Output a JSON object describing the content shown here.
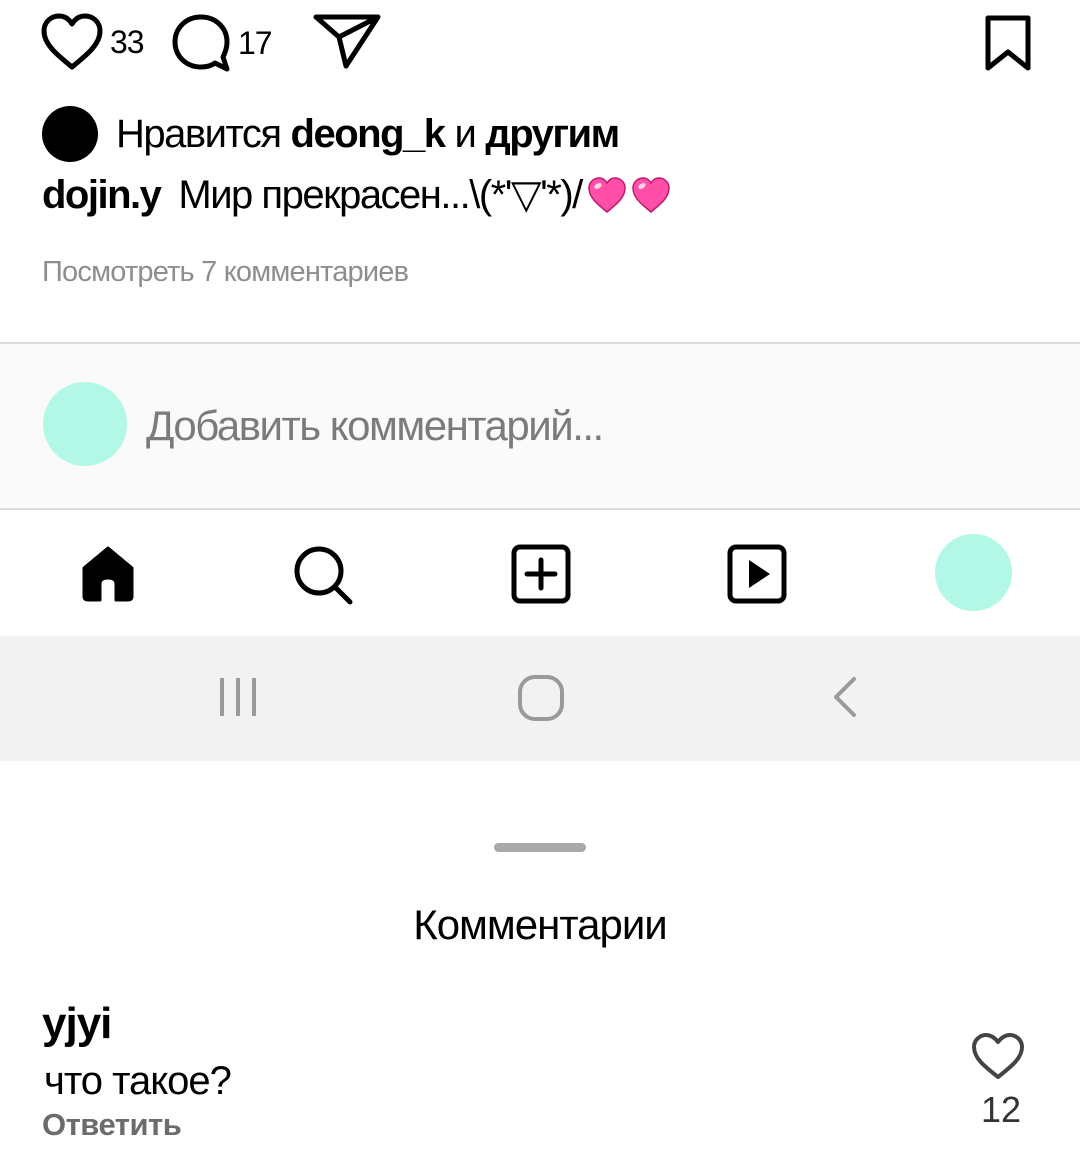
{
  "post": {
    "likes_count": "33",
    "comments_count": "17",
    "likes_prefix": "Нравится",
    "likes_user": "deong_k",
    "likes_and": "и",
    "likes_others": "другим",
    "caption_user": "dojin.y",
    "caption_text": "Мир прекрасен...\\(*'▽'*)/",
    "caption_emoji": [
      "pink-heart-icon",
      "pink-heart-icon"
    ],
    "view_comments": "Посмотреть 7 комментариев"
  },
  "add_comment": {
    "placeholder": "Добавить комментарий..."
  },
  "bottom_nav": [
    "home-icon",
    "search-icon",
    "add-post-icon",
    "reels-icon",
    "profile-avatar"
  ],
  "system_nav": [
    "recents-icon",
    "home-circle-icon",
    "back-icon"
  ],
  "comments_sheet": {
    "title": "Комментарии",
    "comments": [
      {
        "user": "yjyi",
        "text": "что такое?",
        "reply": "Ответить",
        "likes": "12"
      }
    ]
  },
  "colors": {
    "avatar": "#b3f7e6",
    "strip_bg": "#fafafa",
    "system_nav_bg": "#f2f2f2",
    "muted_text": "#8e8e8e",
    "heart_emoji": "#ff4fa8"
  }
}
